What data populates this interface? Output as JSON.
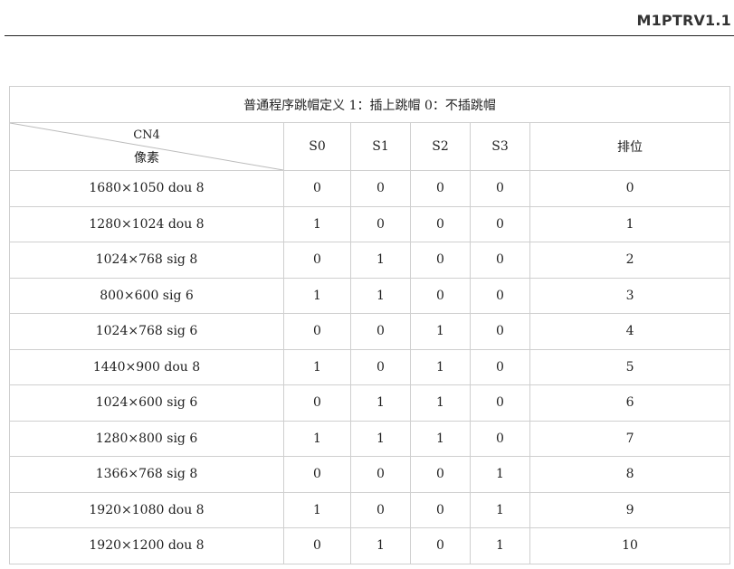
{
  "doc_header": {
    "title": "M1PTRV1.1"
  },
  "table": {
    "title": "普通程序跳帽定义 1：插上跳帽 0：不插跳帽",
    "corner_top": "CN4",
    "corner_bottom": "像素",
    "columns": [
      "S0",
      "S1",
      "S2",
      "S3",
      "排位"
    ],
    "rows": [
      {
        "label": "1680×1050 dou 8",
        "values": [
          "0",
          "0",
          "0",
          "0",
          "0"
        ]
      },
      {
        "label": "1280×1024 dou 8",
        "values": [
          "1",
          "0",
          "0",
          "0",
          "1"
        ]
      },
      {
        "label": "1024×768 sig 8",
        "values": [
          "0",
          "1",
          "0",
          "0",
          "2"
        ]
      },
      {
        "label": "800×600 sig 6",
        "values": [
          "1",
          "1",
          "0",
          "0",
          "3"
        ]
      },
      {
        "label": "1024×768 sig 6",
        "values": [
          "0",
          "0",
          "1",
          "0",
          "4"
        ]
      },
      {
        "label": "1440×900 dou 8",
        "values": [
          "1",
          "0",
          "1",
          "0",
          "5"
        ]
      },
      {
        "label": "1024×600 sig 6",
        "values": [
          "0",
          "1",
          "1",
          "0",
          "6"
        ]
      },
      {
        "label": "1280×800 sig 6",
        "values": [
          "1",
          "1",
          "1",
          "0",
          "7"
        ]
      },
      {
        "label": "1366×768 sig 8",
        "values": [
          "0",
          "0",
          "0",
          "1",
          "8"
        ]
      },
      {
        "label": "1920×1080 dou 8",
        "values": [
          "1",
          "0",
          "0",
          "1",
          "9"
        ]
      },
      {
        "label": "1920×1200 dou 8",
        "values": [
          "0",
          "1",
          "0",
          "1",
          "10"
        ]
      }
    ]
  }
}
